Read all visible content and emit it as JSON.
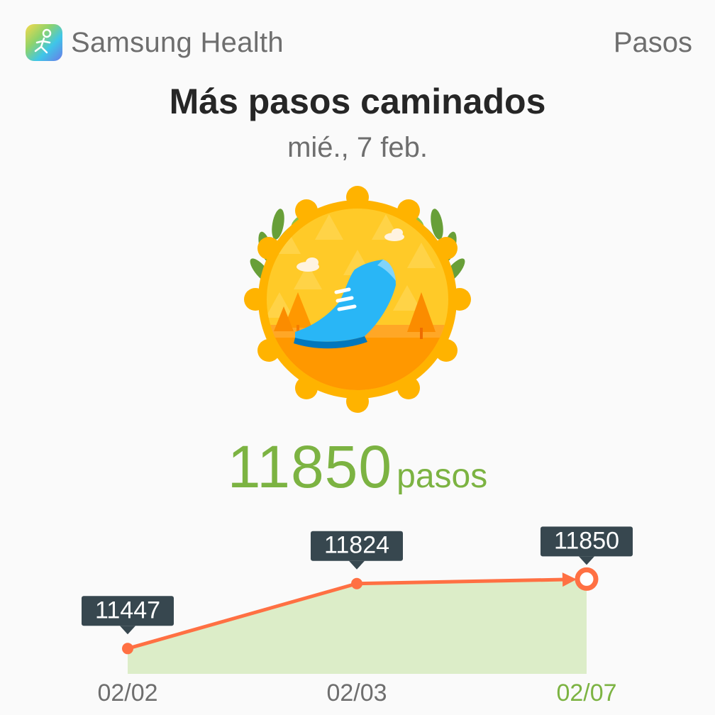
{
  "header": {
    "app_name": "Samsung Health",
    "section": "Pasos",
    "app_icon": "samsung-health-runner-icon"
  },
  "achievement": {
    "title": "Más pasos caminados",
    "date": "mié., 7 feb.",
    "badge_icon": "running-shoe-medal-icon"
  },
  "steps": {
    "value": "11850",
    "unit": "pasos"
  },
  "colors": {
    "accent_green": "#7cb342",
    "line_orange": "#ff7043",
    "area_green": "#dcedc8",
    "tooltip_dark": "#37474f",
    "text_gray": "#6e6e6e"
  },
  "chart_data": {
    "type": "line",
    "categories": [
      "02/02",
      "02/03",
      "02/07"
    ],
    "values": [
      11447,
      11824,
      11850
    ],
    "data_labels": [
      "11447",
      "11824",
      "11850"
    ],
    "highlight_index": 2,
    "ylim": [
      11300,
      12000
    ],
    "grid": false,
    "title": "",
    "xlabel": "",
    "ylabel": ""
  }
}
